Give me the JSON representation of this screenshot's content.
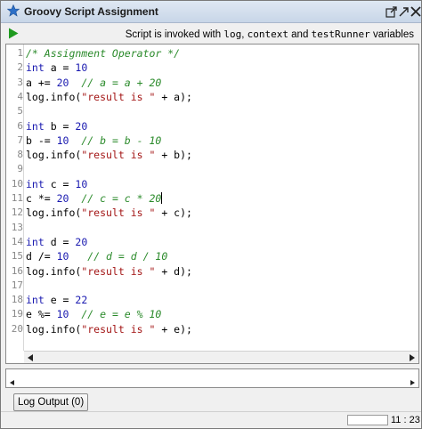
{
  "window": {
    "title": "Groovy Script Assignment"
  },
  "toolbar": {
    "hint_prefix": "Script is invoked with ",
    "hint_var1": "log",
    "hint_sep1": ", ",
    "hint_var2": "context",
    "hint_sep2": " and ",
    "hint_var3": "testRunner",
    "hint_suffix": " variables"
  },
  "editor": {
    "line_numbers": [
      "1",
      "2",
      "3",
      "4",
      "5",
      "6",
      "7",
      "8",
      "9",
      "10",
      "11",
      "12",
      "13",
      "14",
      "15",
      "16",
      "17",
      "18",
      "19",
      "20"
    ],
    "lines": [
      [
        {
          "t": "/* Assignment Operator */",
          "c": "cmt"
        }
      ],
      [
        {
          "t": "int",
          "c": "kw"
        },
        {
          "t": " a = ",
          "c": ""
        },
        {
          "t": "10",
          "c": "num"
        }
      ],
      [
        {
          "t": "a += ",
          "c": ""
        },
        {
          "t": "20",
          "c": "num"
        },
        {
          "t": "  ",
          "c": ""
        },
        {
          "t": "// a = a + 20",
          "c": "cmt"
        }
      ],
      [
        {
          "t": "log.info(",
          "c": ""
        },
        {
          "t": "\"result is \"",
          "c": "str"
        },
        {
          "t": " + a);",
          "c": ""
        }
      ],
      [],
      [
        {
          "t": "int",
          "c": "kw"
        },
        {
          "t": " b = ",
          "c": ""
        },
        {
          "t": "20",
          "c": "num"
        }
      ],
      [
        {
          "t": "b -= ",
          "c": ""
        },
        {
          "t": "10",
          "c": "num"
        },
        {
          "t": "  ",
          "c": ""
        },
        {
          "t": "// b = b - 10",
          "c": "cmt"
        }
      ],
      [
        {
          "t": "log.info(",
          "c": ""
        },
        {
          "t": "\"result is \"",
          "c": "str"
        },
        {
          "t": " + b);",
          "c": ""
        }
      ],
      [],
      [
        {
          "t": "int",
          "c": "kw"
        },
        {
          "t": " c = ",
          "c": ""
        },
        {
          "t": "10",
          "c": "num"
        }
      ],
      [
        {
          "t": "c *= ",
          "c": ""
        },
        {
          "t": "20",
          "c": "num"
        },
        {
          "t": "  ",
          "c": ""
        },
        {
          "t": "// c = c * 20",
          "c": "cmt"
        }
      ],
      [
        {
          "t": "log.info(",
          "c": ""
        },
        {
          "t": "\"result is \"",
          "c": "str"
        },
        {
          "t": " + c);",
          "c": ""
        }
      ],
      [],
      [
        {
          "t": "int",
          "c": "kw"
        },
        {
          "t": " d = ",
          "c": ""
        },
        {
          "t": "20",
          "c": "num"
        }
      ],
      [
        {
          "t": "d /= ",
          "c": ""
        },
        {
          "t": "10",
          "c": "num"
        },
        {
          "t": "   ",
          "c": ""
        },
        {
          "t": "// d = d / 10",
          "c": "cmt"
        }
      ],
      [
        {
          "t": "log.info(",
          "c": ""
        },
        {
          "t": "\"result is \"",
          "c": "str"
        },
        {
          "t": " + d);",
          "c": ""
        }
      ],
      [],
      [
        {
          "t": "int",
          "c": "kw"
        },
        {
          "t": " e = ",
          "c": ""
        },
        {
          "t": "22",
          "c": "num"
        }
      ],
      [
        {
          "t": "e %= ",
          "c": ""
        },
        {
          "t": "10",
          "c": "num"
        },
        {
          "t": "  ",
          "c": ""
        },
        {
          "t": "// e = e % 10",
          "c": "cmt"
        }
      ],
      [
        {
          "t": "log.info(",
          "c": ""
        },
        {
          "t": "\"result is \"",
          "c": "str"
        },
        {
          "t": " + e);",
          "c": ""
        }
      ]
    ],
    "caret_line": 11
  },
  "log_tab": {
    "label": "Log Output (0)"
  },
  "status": {
    "cursor_position": "11 : 23"
  },
  "colors": {
    "keyword": "#1a1ab0",
    "string": "#a31515",
    "comment": "#2a8a2a",
    "run_green": "#1f9a1f"
  },
  "icons": {
    "title": "star-icon",
    "run": "play-icon",
    "undock": "undock-icon",
    "maximize": "maximize-icon",
    "close": "close-icon"
  }
}
